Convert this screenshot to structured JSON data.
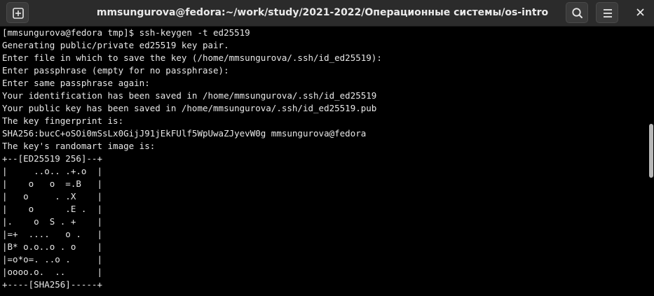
{
  "window": {
    "title": "mmsungurova@fedora:~/work/study/2021-2022/Операционные системы/os-intro"
  },
  "icons": {
    "new_tab": "new-tab-plus-icon",
    "search": "search-icon",
    "menu": "hamburger-menu-icon",
    "close": "close-icon"
  },
  "colors": {
    "titlebar_bg": "#2b2b2b",
    "terminal_bg": "#000000",
    "terminal_fg": "#e8e8e8"
  },
  "terminal": {
    "lines": [
      "[mmsungurova@fedora tmp]$ ssh-keygen -t ed25519",
      "Generating public/private ed25519 key pair.",
      "Enter file in which to save the key (/home/mmsungurova/.ssh/id_ed25519):",
      "Enter passphrase (empty for no passphrase):",
      "Enter same passphrase again:",
      "Your identification has been saved in /home/mmsungurova/.ssh/id_ed25519",
      "Your public key has been saved in /home/mmsungurova/.ssh/id_ed25519.pub",
      "The key fingerprint is:",
      "SHA256:bucC+oSOi0mSsLx0GijJ91jEkFUlf5WpUwaZJyevW0g mmsungurova@fedora",
      "The key's randomart image is:",
      "+--[ED25519 256]--+",
      "|     ..o.. .+.o  |",
      "|    o   o  =.B   |",
      "|   o     . .X    |",
      "|    o      .E .  |",
      "|.    o  S . +    |",
      "|=+  ....   o .   |",
      "|B* o.o..o . o    |",
      "|=o*o=. ..o .     |",
      "|oooo.o.  ..      |",
      "+----[SHA256]-----+"
    ]
  },
  "scrollbar": {
    "thumb_position_fraction": 0.36,
    "thumb_size_fraction": 0.2
  }
}
